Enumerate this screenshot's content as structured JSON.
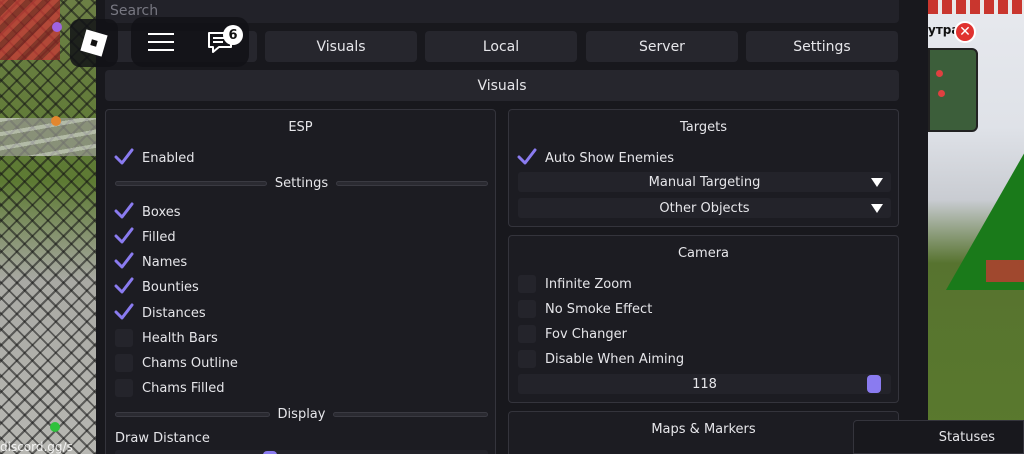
{
  "search": {
    "placeholder": "Search"
  },
  "topbar": {
    "chat_badge_count": "6"
  },
  "tabs": [
    {
      "label": ""
    },
    {
      "label": "Visuals"
    },
    {
      "label": "Local"
    },
    {
      "label": "Server"
    },
    {
      "label": "Settings"
    }
  ],
  "section_title": "Visuals",
  "esp": {
    "title": "ESP",
    "enabled": {
      "label": "Enabled",
      "checked": true
    },
    "settings_divider": "Settings",
    "options": [
      {
        "label": "Boxes",
        "checked": true
      },
      {
        "label": "Filled",
        "checked": true
      },
      {
        "label": "Names",
        "checked": true
      },
      {
        "label": "Bounties",
        "checked": true
      },
      {
        "label": "Distances",
        "checked": true
      },
      {
        "label": "Health Bars",
        "checked": false
      },
      {
        "label": "Chams Outline",
        "checked": false
      },
      {
        "label": "Chams Filled",
        "checked": false
      }
    ],
    "display_divider": "Display",
    "draw_distance_label": "Draw Distance"
  },
  "targets": {
    "title": "Targets",
    "auto_show": {
      "label": "Auto Show Enemies",
      "checked": true
    },
    "dropdowns": [
      {
        "label": "Manual Targeting"
      },
      {
        "label": "Other Objects"
      }
    ]
  },
  "camera": {
    "title": "Camera",
    "options": [
      {
        "label": "Infinite Zoom",
        "checked": false
      },
      {
        "label": "No Smoke Effect",
        "checked": false
      },
      {
        "label": "Fov Changer",
        "checked": false
      },
      {
        "label": "Disable When Aiming",
        "checked": false
      }
    ],
    "fov_value": "118"
  },
  "maps": {
    "title": "Maps & Markers"
  },
  "statuses_label": "Statuses",
  "overlay": {
    "name_fragment": "утра"
  },
  "background_text": "discord.gg/s",
  "colors": {
    "accent": "#8a7bf0",
    "panel_bg": "#18181d",
    "control_bg": "#26262d"
  }
}
